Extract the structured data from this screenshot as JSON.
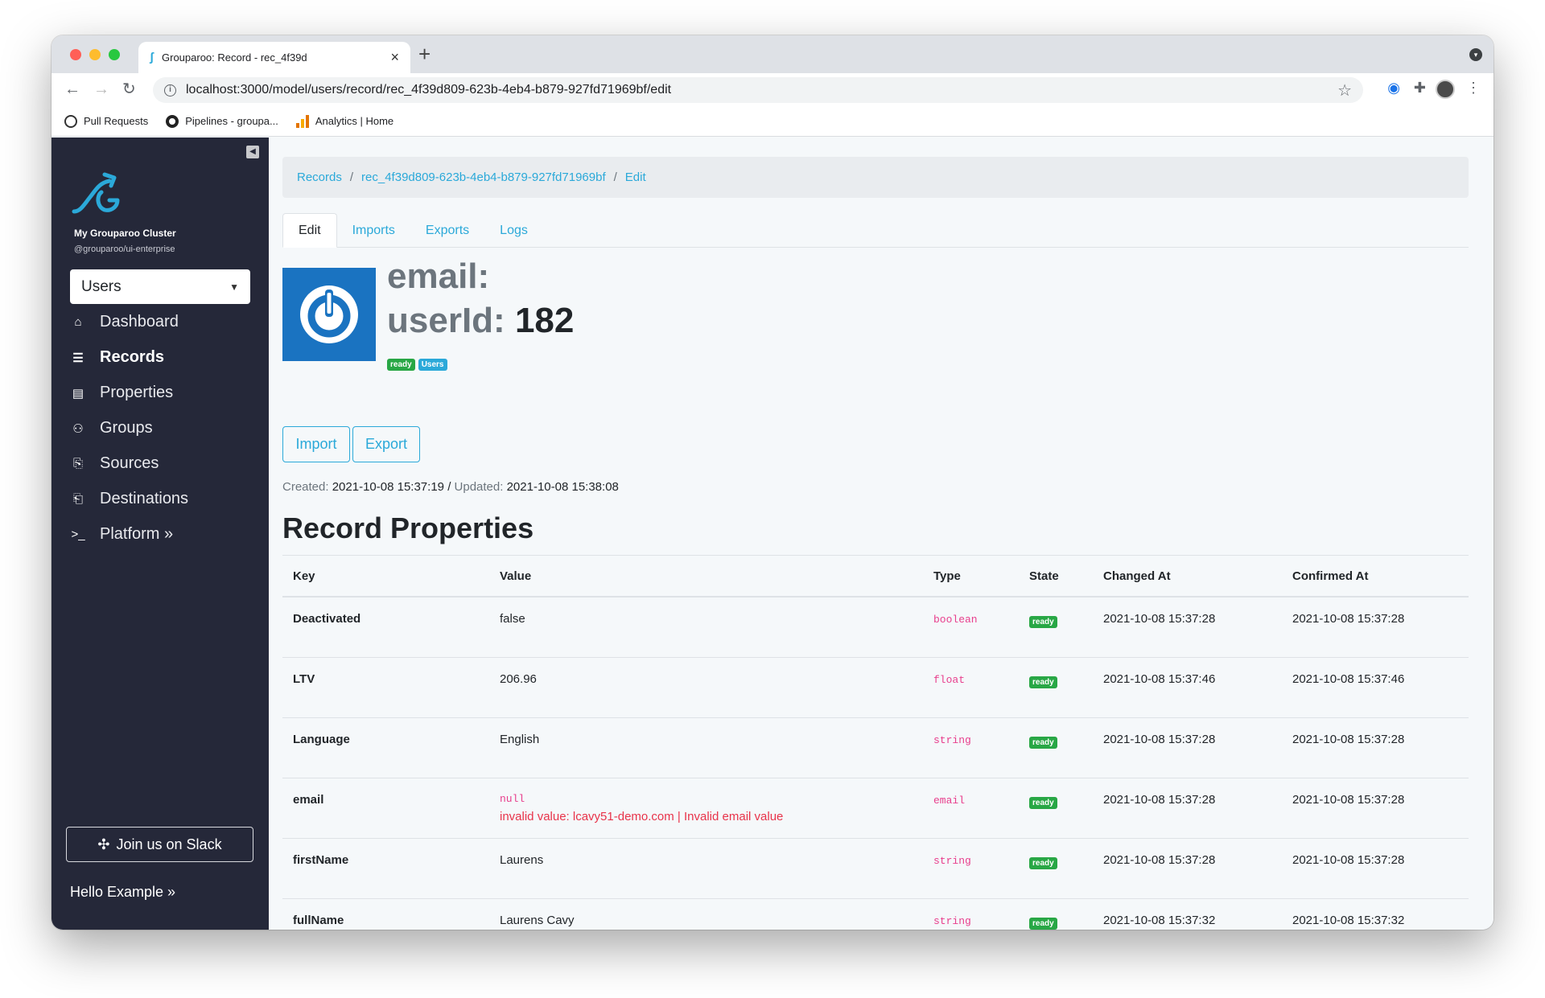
{
  "browser": {
    "tab_title": "Grouparoo: Record - rec_4f39d",
    "url": "localhost:3000/model/users/record/rec_4f39d809-623b-4eb4-b879-927fd71969bf/edit",
    "bookmarks": [
      {
        "label": "Pull Requests"
      },
      {
        "label": "Pipelines - groupa..."
      },
      {
        "label": "Analytics | Home"
      }
    ]
  },
  "sidebar": {
    "cluster_name": "My Grouparoo Cluster",
    "cluster_package": "@grouparoo/ui-enterprise",
    "model_select": "Users",
    "items": [
      {
        "label": "Dashboard",
        "icon": "home-icon"
      },
      {
        "label": "Records",
        "icon": "list-icon"
      },
      {
        "label": "Properties",
        "icon": "id-card-icon"
      },
      {
        "label": "Groups",
        "icon": "users-icon"
      },
      {
        "label": "Sources",
        "icon": "file-import-icon"
      },
      {
        "label": "Destinations",
        "icon": "file-export-icon"
      },
      {
        "label": "Platform »",
        "icon": "terminal-icon"
      }
    ],
    "slack_button": "Join us on Slack",
    "hello": "Hello Example »"
  },
  "breadcrumb": [
    "Records",
    "rec_4f39d809-623b-4eb4-b879-927fd71969bf",
    "Edit"
  ],
  "tabs": [
    "Edit",
    "Imports",
    "Exports",
    "Logs"
  ],
  "record": {
    "email_label": "email:",
    "userid_label": "userId:",
    "userid_value": "182",
    "badges": [
      "ready",
      "Users"
    ]
  },
  "actions": {
    "import": "Import",
    "export": "Export"
  },
  "timestamps": {
    "created_label": "Created:",
    "created_value": "2021-10-08 15:37:19",
    "slash": "/",
    "updated_label": "Updated:",
    "updated_value": "2021-10-08 15:38:08"
  },
  "section_title": "Record Properties",
  "table": {
    "headers": [
      "Key",
      "Value",
      "Type",
      "State",
      "Changed At",
      "Confirmed At"
    ],
    "rows": [
      {
        "key": "Deactivated",
        "value": "false",
        "type": "boolean",
        "state": "ready",
        "changed": "2021-10-08 15:37:28",
        "confirmed": "2021-10-08 15:37:28"
      },
      {
        "key": "LTV",
        "value": "206.96",
        "type": "float",
        "state": "ready",
        "changed": "2021-10-08 15:37:46",
        "confirmed": "2021-10-08 15:37:46"
      },
      {
        "key": "Language",
        "value": "English",
        "type": "string",
        "state": "ready",
        "changed": "2021-10-08 15:37:28",
        "confirmed": "2021-10-08 15:37:28"
      },
      {
        "key": "email",
        "value": "null",
        "error": "invalid value: lcavy51-demo.com | Invalid email value",
        "type": "email",
        "state": "ready",
        "changed": "2021-10-08 15:37:28",
        "confirmed": "2021-10-08 15:37:28"
      },
      {
        "key": "firstName",
        "value": "Laurens",
        "type": "string",
        "state": "ready",
        "changed": "2021-10-08 15:37:28",
        "confirmed": "2021-10-08 15:37:28"
      },
      {
        "key": "fullName",
        "value": "Laurens Cavy",
        "type": "string",
        "state": "ready",
        "changed": "2021-10-08 15:37:32",
        "confirmed": "2021-10-08 15:37:32"
      }
    ]
  },
  "colors": {
    "sidebar_bg": "#252839",
    "accent": "#2ba9d9",
    "ready_green": "#28a745",
    "type_pink": "#e83e8c",
    "error_red": "#e8334a"
  }
}
